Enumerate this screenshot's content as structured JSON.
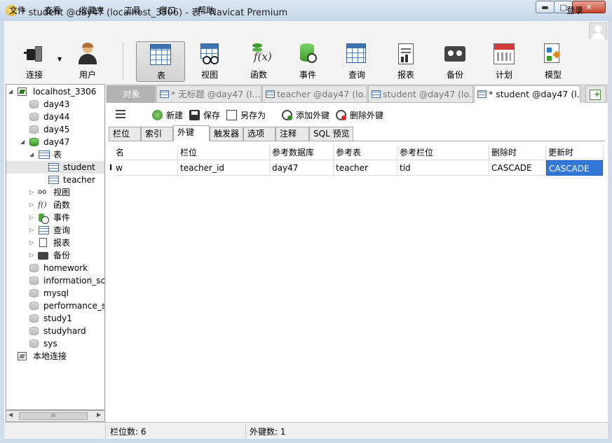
{
  "window": {
    "title": "* student @day47 (localhost_3306) - 表 - Navicat Premium",
    "min_glyph": "▬",
    "max_glyph": "□",
    "close_glyph": "✕"
  },
  "menu": [
    "文件",
    "查看",
    "收藏夹",
    "工具",
    "窗口",
    "帮助"
  ],
  "login_label": "登录",
  "toolbar": {
    "items": [
      {
        "label": "连接",
        "icon": "plug-icon"
      },
      {
        "label": "用户",
        "icon": "user-icon"
      },
      {
        "label": "表",
        "icon": "table-icon",
        "active": true
      },
      {
        "label": "视图",
        "icon": "view-icon"
      },
      {
        "label": "函数",
        "icon": "function-icon"
      },
      {
        "label": "事件",
        "icon": "event-icon"
      },
      {
        "label": "查询",
        "icon": "query-icon"
      },
      {
        "label": "报表",
        "icon": "report-icon"
      },
      {
        "label": "备份",
        "icon": "backup-icon"
      },
      {
        "label": "计划",
        "icon": "schedule-icon"
      },
      {
        "label": "模型",
        "icon": "model-icon"
      }
    ],
    "function_glyph": "f(x)"
  },
  "tree": {
    "connection": "localhost_3306",
    "databases_top": [
      "day43",
      "day44",
      "day45"
    ],
    "current_db": "day47",
    "tables_label": "表",
    "tables": [
      "student",
      "teacher"
    ],
    "objects": [
      {
        "label": "视图",
        "icon": "view-icon"
      },
      {
        "label": "函数",
        "icon": "function-icon"
      },
      {
        "label": "事件",
        "icon": "event-icon"
      },
      {
        "label": "查询",
        "icon": "query-icon"
      },
      {
        "label": "报表",
        "icon": "report-icon"
      },
      {
        "label": "备份",
        "icon": "backup-icon"
      }
    ],
    "databases_bottom": [
      "homework",
      "information_sch",
      "mysql",
      "performance_s",
      "study1",
      "studyhard",
      "sys"
    ],
    "local_connection": "本地连接",
    "func_glyph": "f()",
    "scroll_thumb_glyph": "III",
    "scroll_left_glyph": "◀",
    "scroll_right_glyph": "▶"
  },
  "tabs": [
    {
      "label": "对象"
    },
    {
      "label": "* 无标题 @day47 (l..."
    },
    {
      "label": "teacher @day47 (lo..."
    },
    {
      "label": "student @day47 (lo..."
    },
    {
      "label": "* student @day47 (l..."
    }
  ],
  "editor_toolbar": {
    "new": "新建",
    "save": "保存",
    "save_as": "另存为",
    "add_fk": "添加外键",
    "delete_fk": "删除外键"
  },
  "subtabs": [
    "栏位",
    "索引",
    "外键",
    "触发器",
    "选项",
    "注释",
    "SQL 预览"
  ],
  "grid": {
    "columns": [
      "名",
      "栏位",
      "参考数据库",
      "参考表",
      "参考栏位",
      "删除时",
      "更新时"
    ],
    "rows": [
      [
        "w",
        "teacher_id",
        "day47",
        "teacher",
        "tid",
        "CASCADE",
        "CASCADE"
      ]
    ],
    "row_cursor": "I"
  },
  "status": {
    "fields": "栏位数: 6",
    "fks": "外键数: 1"
  }
}
